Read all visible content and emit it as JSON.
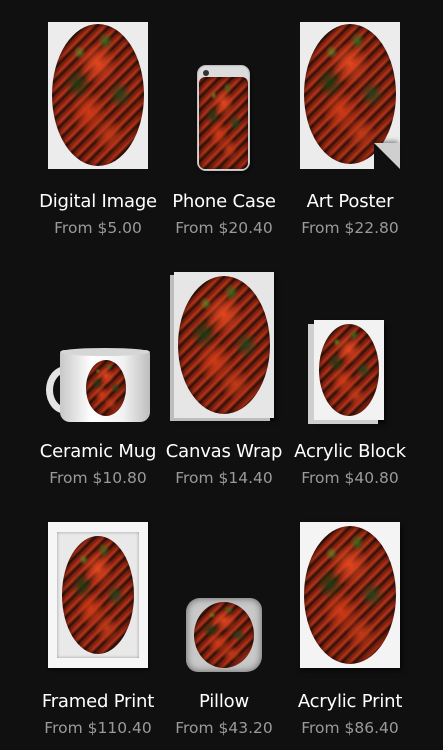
{
  "products": [
    {
      "name": "Digital Image",
      "price": "From $5.00",
      "icon": "digital-image-icon"
    },
    {
      "name": "Phone Case",
      "price": "From $20.40",
      "icon": "phone-case-icon"
    },
    {
      "name": "Art Poster",
      "price": "From $22.80",
      "icon": "art-poster-icon"
    },
    {
      "name": "Ceramic Mug",
      "price": "From $10.80",
      "icon": "ceramic-mug-icon"
    },
    {
      "name": "Canvas Wrap",
      "price": "From $14.40",
      "icon": "canvas-wrap-icon"
    },
    {
      "name": "Acrylic Block",
      "price": "From $40.80",
      "icon": "acrylic-block-icon"
    },
    {
      "name": "Framed Print",
      "price": "From $110.40",
      "icon": "framed-print-icon"
    },
    {
      "name": "Pillow",
      "price": "From $43.20",
      "icon": "pillow-icon"
    },
    {
      "name": "Acrylic Print",
      "price": "From $86.40",
      "icon": "acrylic-print-icon"
    }
  ],
  "colors": {
    "background": "#101010",
    "title": "#ffffff",
    "price": "#9a9a9a"
  }
}
